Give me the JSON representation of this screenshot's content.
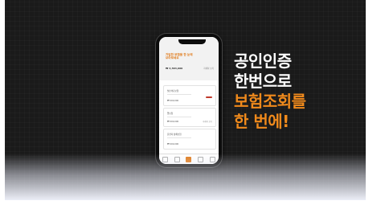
{
  "headline": {
    "line1": "공인인증",
    "line2": "한번으로",
    "line3": "보험조회를",
    "line4": "한 번에!"
  },
  "colors": {
    "background": "#1a1a1a",
    "accent_orange": "#f08a1c",
    "text_white": "#ffffff"
  },
  "phone_screen": {
    "header_title": "가입한 보험을 \n 한 눈에 모아보세요",
    "header_amount": "₩ 4,583,000",
    "header_link": "자세히 보기",
    "cards": [
      {
        "name": "실손의료보험",
        "amount": "₩ 000,000",
        "link": ""
      },
      {
        "name": "암보험",
        "amount": "₩ 000,000",
        "link": "자세히 보기"
      },
      {
        "name": "운전자 상해보험",
        "amount": "₩ 000,000",
        "link": ""
      }
    ],
    "tab_icons": [
      "home-icon",
      "search-icon",
      "report-icon",
      "chat-icon",
      "menu-icon"
    ]
  }
}
